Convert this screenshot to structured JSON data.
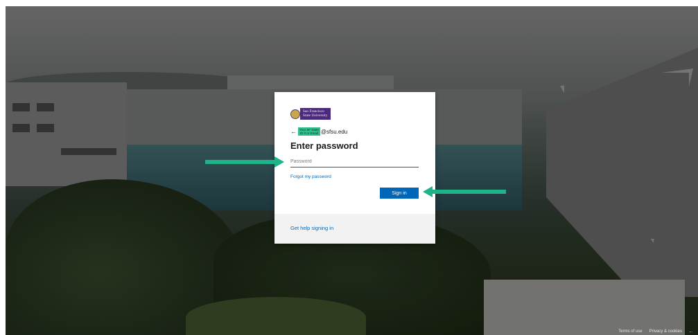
{
  "university_logo": {
    "line1": "San Francisco",
    "line2": "State University"
  },
  "identity": {
    "back_icon": "back-arrow-icon",
    "tag_line1": "Your SF State",
    "tag_line2": "ID # or Email",
    "domain": "@sfsu.edu"
  },
  "title": "Enter password",
  "password": {
    "placeholder": "Password",
    "value": ""
  },
  "forgot_link": "Forgot my password",
  "signin_button": "Sign in",
  "help_link": "Get help signing in",
  "footer": {
    "terms": "Terms of use",
    "privacy": "Privacy & cookies",
    "more": "..."
  },
  "colors": {
    "accent": "#0067b8",
    "annotation": "#1fb38a",
    "brand_purple": "#4b2a7b"
  }
}
